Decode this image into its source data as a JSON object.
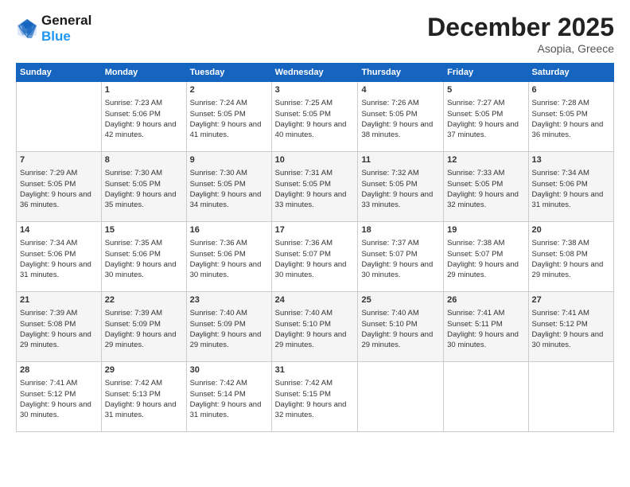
{
  "header": {
    "logo_line1": "General",
    "logo_line2": "Blue",
    "month_title": "December 2025",
    "subtitle": "Asopia, Greece"
  },
  "days_of_week": [
    "Sunday",
    "Monday",
    "Tuesday",
    "Wednesday",
    "Thursday",
    "Friday",
    "Saturday"
  ],
  "weeks": [
    [
      {
        "day": "",
        "data": ""
      },
      {
        "day": "1",
        "sunrise": "Sunrise: 7:23 AM",
        "sunset": "Sunset: 5:06 PM",
        "daylight": "Daylight: 9 hours and 42 minutes."
      },
      {
        "day": "2",
        "sunrise": "Sunrise: 7:24 AM",
        "sunset": "Sunset: 5:05 PM",
        "daylight": "Daylight: 9 hours and 41 minutes."
      },
      {
        "day": "3",
        "sunrise": "Sunrise: 7:25 AM",
        "sunset": "Sunset: 5:05 PM",
        "daylight": "Daylight: 9 hours and 40 minutes."
      },
      {
        "day": "4",
        "sunrise": "Sunrise: 7:26 AM",
        "sunset": "Sunset: 5:05 PM",
        "daylight": "Daylight: 9 hours and 38 minutes."
      },
      {
        "day": "5",
        "sunrise": "Sunrise: 7:27 AM",
        "sunset": "Sunset: 5:05 PM",
        "daylight": "Daylight: 9 hours and 37 minutes."
      },
      {
        "day": "6",
        "sunrise": "Sunrise: 7:28 AM",
        "sunset": "Sunset: 5:05 PM",
        "daylight": "Daylight: 9 hours and 36 minutes."
      }
    ],
    [
      {
        "day": "7",
        "sunrise": "Sunrise: 7:29 AM",
        "sunset": "Sunset: 5:05 PM",
        "daylight": "Daylight: 9 hours and 36 minutes."
      },
      {
        "day": "8",
        "sunrise": "Sunrise: 7:30 AM",
        "sunset": "Sunset: 5:05 PM",
        "daylight": "Daylight: 9 hours and 35 minutes."
      },
      {
        "day": "9",
        "sunrise": "Sunrise: 7:30 AM",
        "sunset": "Sunset: 5:05 PM",
        "daylight": "Daylight: 9 hours and 34 minutes."
      },
      {
        "day": "10",
        "sunrise": "Sunrise: 7:31 AM",
        "sunset": "Sunset: 5:05 PM",
        "daylight": "Daylight: 9 hours and 33 minutes."
      },
      {
        "day": "11",
        "sunrise": "Sunrise: 7:32 AM",
        "sunset": "Sunset: 5:05 PM",
        "daylight": "Daylight: 9 hours and 33 minutes."
      },
      {
        "day": "12",
        "sunrise": "Sunrise: 7:33 AM",
        "sunset": "Sunset: 5:05 PM",
        "daylight": "Daylight: 9 hours and 32 minutes."
      },
      {
        "day": "13",
        "sunrise": "Sunrise: 7:34 AM",
        "sunset": "Sunset: 5:06 PM",
        "daylight": "Daylight: 9 hours and 31 minutes."
      }
    ],
    [
      {
        "day": "14",
        "sunrise": "Sunrise: 7:34 AM",
        "sunset": "Sunset: 5:06 PM",
        "daylight": "Daylight: 9 hours and 31 minutes."
      },
      {
        "day": "15",
        "sunrise": "Sunrise: 7:35 AM",
        "sunset": "Sunset: 5:06 PM",
        "daylight": "Daylight: 9 hours and 30 minutes."
      },
      {
        "day": "16",
        "sunrise": "Sunrise: 7:36 AM",
        "sunset": "Sunset: 5:06 PM",
        "daylight": "Daylight: 9 hours and 30 minutes."
      },
      {
        "day": "17",
        "sunrise": "Sunrise: 7:36 AM",
        "sunset": "Sunset: 5:07 PM",
        "daylight": "Daylight: 9 hours and 30 minutes."
      },
      {
        "day": "18",
        "sunrise": "Sunrise: 7:37 AM",
        "sunset": "Sunset: 5:07 PM",
        "daylight": "Daylight: 9 hours and 30 minutes."
      },
      {
        "day": "19",
        "sunrise": "Sunrise: 7:38 AM",
        "sunset": "Sunset: 5:07 PM",
        "daylight": "Daylight: 9 hours and 29 minutes."
      },
      {
        "day": "20",
        "sunrise": "Sunrise: 7:38 AM",
        "sunset": "Sunset: 5:08 PM",
        "daylight": "Daylight: 9 hours and 29 minutes."
      }
    ],
    [
      {
        "day": "21",
        "sunrise": "Sunrise: 7:39 AM",
        "sunset": "Sunset: 5:08 PM",
        "daylight": "Daylight: 9 hours and 29 minutes."
      },
      {
        "day": "22",
        "sunrise": "Sunrise: 7:39 AM",
        "sunset": "Sunset: 5:09 PM",
        "daylight": "Daylight: 9 hours and 29 minutes."
      },
      {
        "day": "23",
        "sunrise": "Sunrise: 7:40 AM",
        "sunset": "Sunset: 5:09 PM",
        "daylight": "Daylight: 9 hours and 29 minutes."
      },
      {
        "day": "24",
        "sunrise": "Sunrise: 7:40 AM",
        "sunset": "Sunset: 5:10 PM",
        "daylight": "Daylight: 9 hours and 29 minutes."
      },
      {
        "day": "25",
        "sunrise": "Sunrise: 7:40 AM",
        "sunset": "Sunset: 5:10 PM",
        "daylight": "Daylight: 9 hours and 29 minutes."
      },
      {
        "day": "26",
        "sunrise": "Sunrise: 7:41 AM",
        "sunset": "Sunset: 5:11 PM",
        "daylight": "Daylight: 9 hours and 30 minutes."
      },
      {
        "day": "27",
        "sunrise": "Sunrise: 7:41 AM",
        "sunset": "Sunset: 5:12 PM",
        "daylight": "Daylight: 9 hours and 30 minutes."
      }
    ],
    [
      {
        "day": "28",
        "sunrise": "Sunrise: 7:41 AM",
        "sunset": "Sunset: 5:12 PM",
        "daylight": "Daylight: 9 hours and 30 minutes."
      },
      {
        "day": "29",
        "sunrise": "Sunrise: 7:42 AM",
        "sunset": "Sunset: 5:13 PM",
        "daylight": "Daylight: 9 hours and 31 minutes."
      },
      {
        "day": "30",
        "sunrise": "Sunrise: 7:42 AM",
        "sunset": "Sunset: 5:14 PM",
        "daylight": "Daylight: 9 hours and 31 minutes."
      },
      {
        "day": "31",
        "sunrise": "Sunrise: 7:42 AM",
        "sunset": "Sunset: 5:15 PM",
        "daylight": "Daylight: 9 hours and 32 minutes."
      },
      {
        "day": "",
        "data": ""
      },
      {
        "day": "",
        "data": ""
      },
      {
        "day": "",
        "data": ""
      }
    ]
  ]
}
